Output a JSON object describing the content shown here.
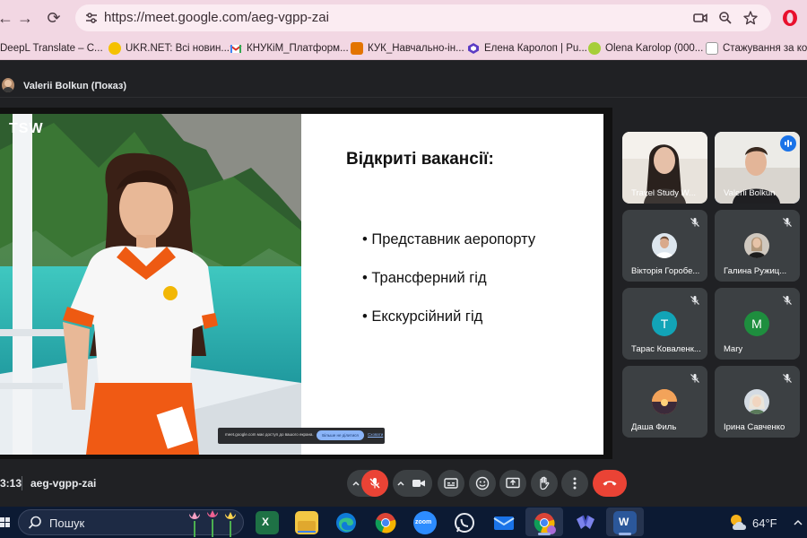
{
  "browser": {
    "url": "https://meet.google.com/aeg-vgpp-zai",
    "bookmarks": [
      {
        "label": "DeepL Translate – C...",
        "color": "#0f2b46"
      },
      {
        "label": "UKR.NET: Всі новин...",
        "color": "#f5c100"
      },
      {
        "label": "КНУКіМ_Платформ...",
        "color": "#d93025"
      },
      {
        "label": "КУК_Навчально-ін...",
        "color": "#e37400"
      },
      {
        "label": "Елена Каролоп | Pu...",
        "color": "#5b3cc4"
      },
      {
        "label": "Olena Karolop (000...",
        "color": "#a6ce39"
      },
      {
        "label": "Стажування за кор...",
        "color": "#222222"
      }
    ]
  },
  "meet": {
    "presenter_label": "Valerii Bolkun (Показ)",
    "slide": {
      "logo": "TSW",
      "title": "Відкриті вакансії:",
      "vacancies": [
        "• Представник аеропорту",
        "• Трансферний гід",
        "• Екскурсійний гід"
      ],
      "share_notice": {
        "text": "meet.google.com має доступ до вашого екрана.",
        "stop_label": "Більше не ділитися",
        "hide_label": "Сховати"
      }
    },
    "participants": [
      {
        "name": "Travel Study W...",
        "kind": "video",
        "muted": false
      },
      {
        "name": "Valerii Bolkun",
        "kind": "video",
        "muted": false,
        "speaking": true
      },
      {
        "name": "Вікторія Горобе...",
        "kind": "photo",
        "muted": true
      },
      {
        "name": "Галина Ружиц...",
        "kind": "photo",
        "muted": true
      },
      {
        "name": "Тарас Коваленк...",
        "kind": "letter",
        "letter": "Т",
        "color": "#12a4b7",
        "muted": true
      },
      {
        "name": "Mary",
        "kind": "letter",
        "letter": "M",
        "color": "#1e8e3e",
        "muted": true
      },
      {
        "name": "Даша Филь",
        "kind": "photo",
        "muted": true
      },
      {
        "name": "Ірина Савченко",
        "kind": "photo",
        "muted": true
      }
    ],
    "time": "3:13",
    "code": "aeg-vgpp-zai",
    "colors": {
      "end_call": "#ea4335",
      "mic_off": "#ea4335",
      "accent": "#8ab4f8"
    }
  },
  "taskbar": {
    "search_label": "Пошук",
    "weather": "64°F",
    "apps": [
      "excel-icon",
      "file-explorer-icon",
      "edge-icon",
      "chrome-icon",
      "zoom-icon",
      "whatsapp-icon",
      "mail-icon",
      "chrome-profile-icon",
      "teams-icon",
      "word-icon"
    ]
  }
}
